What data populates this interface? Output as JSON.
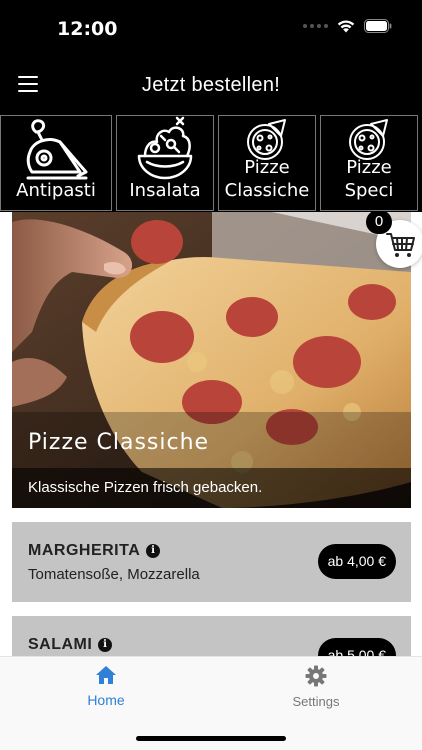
{
  "status": {
    "time": "12:00"
  },
  "header": {
    "title": "Jetzt bestellen!"
  },
  "categories": [
    {
      "label": "Antipasti",
      "icon": "antipasti-icon"
    },
    {
      "label": "Insalata",
      "icon": "salad-bowl-icon"
    },
    {
      "label_line1": "Pizze",
      "label_line2": "Classiche",
      "icon": "pizza-icon"
    },
    {
      "label_line1": "Pizze",
      "label_line2": "Speci",
      "icon": "pizza-icon"
    }
  ],
  "hero": {
    "title": "Pizze Classiche",
    "description": "Klassische Pizzen frisch gebacken."
  },
  "cart": {
    "count": "0"
  },
  "menu_items": [
    {
      "name": "MARGHERITA",
      "description": "Tomatensoße, Mozzarella",
      "price": "ab 4,00 €"
    },
    {
      "name": "SALAMI",
      "description": "",
      "price": "ab 5,00 €"
    }
  ],
  "bottom_nav": {
    "home_label": "Home",
    "settings_label": "Settings"
  },
  "colors": {
    "bar_background": "#000000",
    "card_background": "#c4c4c4",
    "active_tab": "#2f80d6",
    "inactive_tab": "#777777"
  }
}
